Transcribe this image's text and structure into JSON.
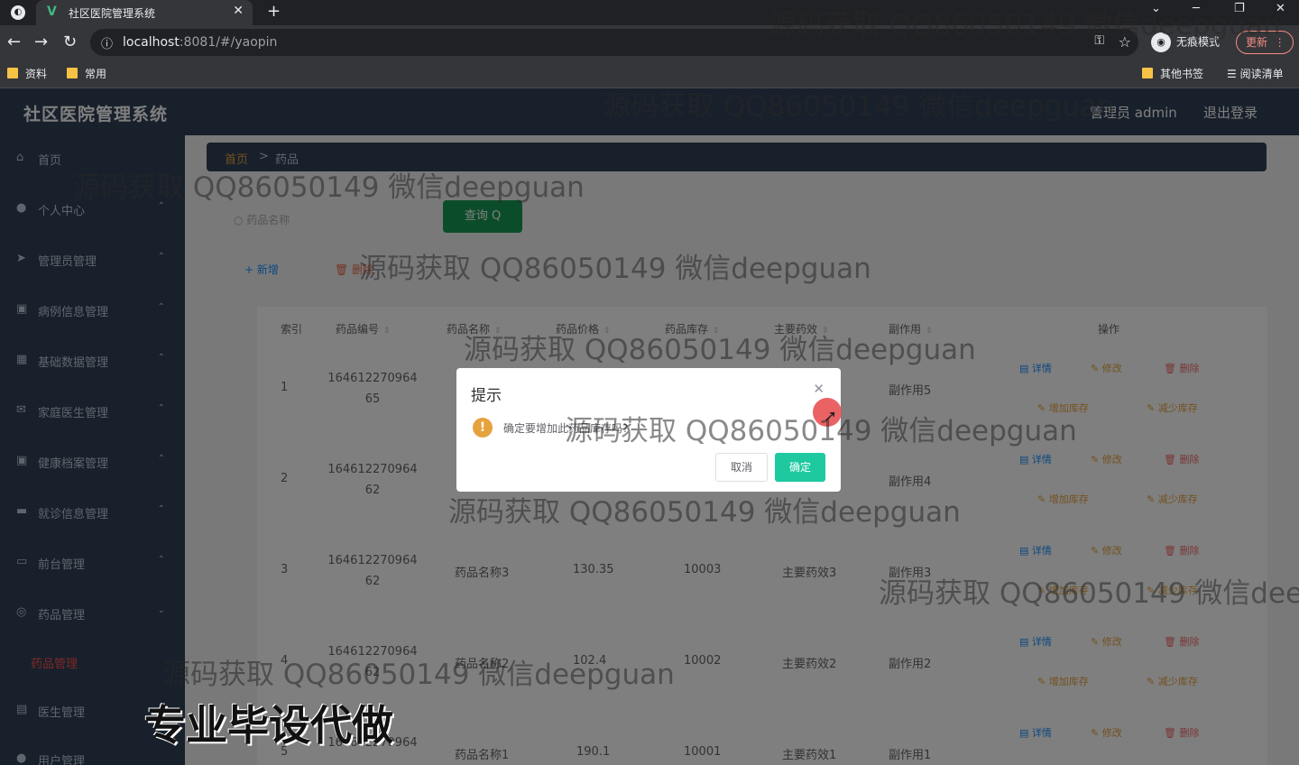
{
  "browser": {
    "tab_title": "社区医院管理系统",
    "url_host": "localhost",
    "url_rest": ":8081/#/yaopin",
    "incognito_label": "无痕模式",
    "update_label": "更新",
    "bookmarks": [
      "资料",
      "常用",
      "其他书签",
      "阅读清单"
    ]
  },
  "header": {
    "brand": "社区医院管理系统",
    "user": "管理员 admin",
    "logout": "退出登录"
  },
  "sidebar": {
    "items": [
      {
        "label": "首页",
        "icon": "home-icon"
      },
      {
        "label": "个人中心",
        "icon": "user-icon"
      },
      {
        "label": "管理员管理",
        "icon": "send-icon"
      },
      {
        "label": "病例信息管理",
        "icon": "form-icon"
      },
      {
        "label": "基础数据管理",
        "icon": "grid-icon"
      },
      {
        "label": "家庭医生管理",
        "icon": "mail-icon"
      },
      {
        "label": "健康档案管理",
        "icon": "form-icon"
      },
      {
        "label": "就诊信息管理",
        "icon": "screen-icon"
      },
      {
        "label": "前台管理",
        "icon": "card-icon"
      },
      {
        "label": "药品管理",
        "icon": "compass-icon"
      },
      {
        "label": "药品管理",
        "icon": ""
      },
      {
        "label": "医生管理",
        "icon": "doc-icon"
      },
      {
        "label": "用户管理",
        "icon": "user-icon"
      }
    ]
  },
  "breadcrumb": {
    "home": "首页",
    "sep": ">",
    "current": "药品"
  },
  "search": {
    "placeholder": "药品名称",
    "query_label": "查询 Q"
  },
  "toolbar": {
    "add_label": "+ 新增",
    "delete_label": "删除"
  },
  "table": {
    "headers": [
      "索引",
      "药品编号",
      "药品名称",
      "药品价格",
      "药品库存",
      "主要药效",
      "副作用",
      "操作"
    ],
    "rows": [
      {
        "index": "1",
        "code1": "164612270964",
        "code2": "65",
        "name": "",
        "price": "",
        "stock": "",
        "effect": "",
        "side": "副作用5"
      },
      {
        "index": "2",
        "code1": "164612270964",
        "code2": "62",
        "name": "",
        "price": "",
        "stock": "",
        "effect": "",
        "side": "副作用4"
      },
      {
        "index": "3",
        "code1": "164612270964",
        "code2": "62",
        "name": "药品名称3",
        "price": "130.35",
        "stock": "10003",
        "effect": "主要药效3",
        "side": "副作用3"
      },
      {
        "index": "4",
        "code1": "164612270964",
        "code2": "62",
        "name": "药品名称2",
        "price": "102.4",
        "stock": "10002",
        "effect": "主要药效2",
        "side": "副作用2"
      },
      {
        "index": "5",
        "code1": "164612270964",
        "code2": "",
        "name": "药品名称1",
        "price": "190.1",
        "stock": "10001",
        "effect": "主要药效1",
        "side": "副作用1"
      }
    ],
    "actions": {
      "detail": "详情",
      "edit": "修改",
      "delete": "删除",
      "add_stock": "增加库存",
      "reduce_stock": "减少库存"
    }
  },
  "dialog": {
    "title": "提示",
    "message": "确定要增加此药品库存吗?",
    "cancel": "取消",
    "confirm": "确定"
  },
  "watermark": "源码获取 QQ86050149 微信deepguan",
  "promo": "专业毕设代做"
}
